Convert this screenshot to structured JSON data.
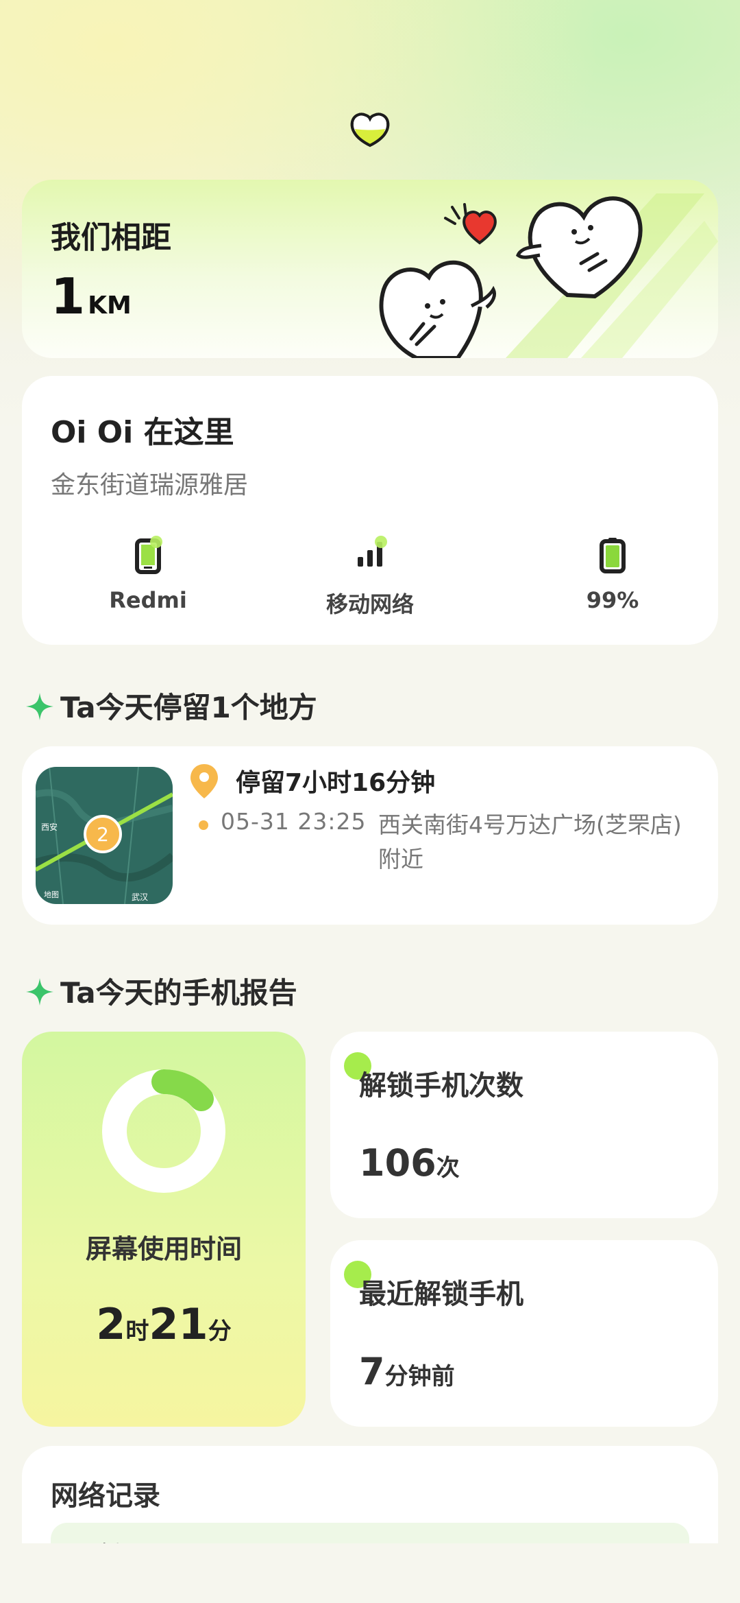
{
  "distance": {
    "title": "我们相距",
    "value": "1",
    "unit": "KM"
  },
  "location": {
    "title": "Oi Oi 在这里",
    "address": "金东街道瑞源雅居",
    "stats": [
      {
        "icon": "phone-icon",
        "label": "Redmi"
      },
      {
        "icon": "signal-bars-icon",
        "label": "移动网络"
      },
      {
        "icon": "battery-icon",
        "label": "99%"
      }
    ]
  },
  "places": {
    "section_title": "Ta今天停留1个地方",
    "stay_duration": "停留7小时16分钟",
    "time": "05-31 23:25",
    "place": "西关南街4号万达广场(芝罘店) 附近",
    "map_count": "2",
    "map_labels": [
      "西安",
      "武汉",
      "地图"
    ]
  },
  "report": {
    "section_title": "Ta今天的手机报告",
    "screen_time": {
      "label": "屏幕使用时间",
      "hours": "2",
      "hours_unit": "时",
      "minutes": "21",
      "minutes_unit": "分"
    },
    "unlock_count": {
      "label": "解锁手机次数",
      "value": "106",
      "unit": "次"
    },
    "last_unlock": {
      "label": "最近解锁手机",
      "value": "7",
      "unit": "分钟前"
    }
  },
  "network": {
    "title": "网络记录",
    "empty_text": "暂无记录"
  },
  "colors": {
    "accent_green": "#a6ec4c",
    "pin_orange": "#f7b84b",
    "heart_red": "#e8382f"
  }
}
